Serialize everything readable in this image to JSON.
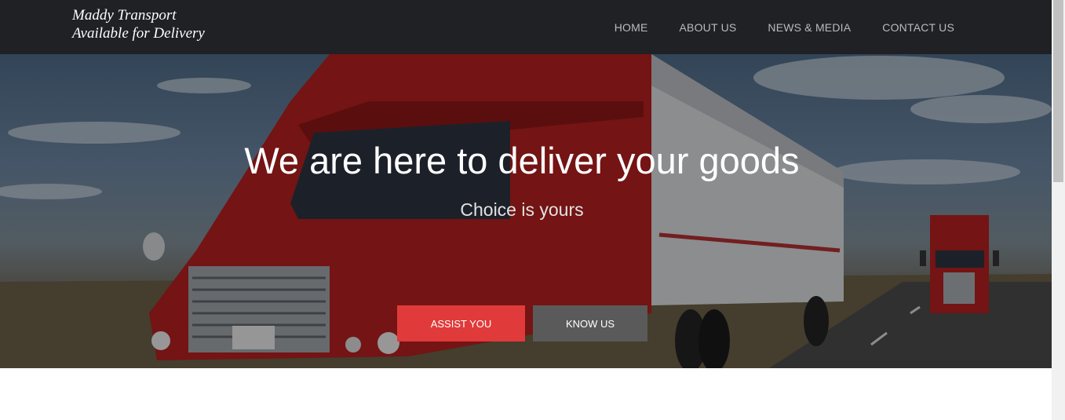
{
  "brand": {
    "line1": "Maddy Transport",
    "line2": "Available for Delivery"
  },
  "nav": {
    "items": [
      "HOME",
      "ABOUT US",
      "NEWS & MEDIA",
      "CONTACT US"
    ]
  },
  "hero": {
    "title": "We are here to deliver your goods",
    "subtitle": "Choice is yours",
    "primary_button": "ASSIST YOU",
    "secondary_button": "KNOW US"
  },
  "colors": {
    "navbar": "#1f2124",
    "primary_button": "#e03a3a",
    "secondary_button": "#5a5a5a",
    "truck": "#b31f1f"
  }
}
